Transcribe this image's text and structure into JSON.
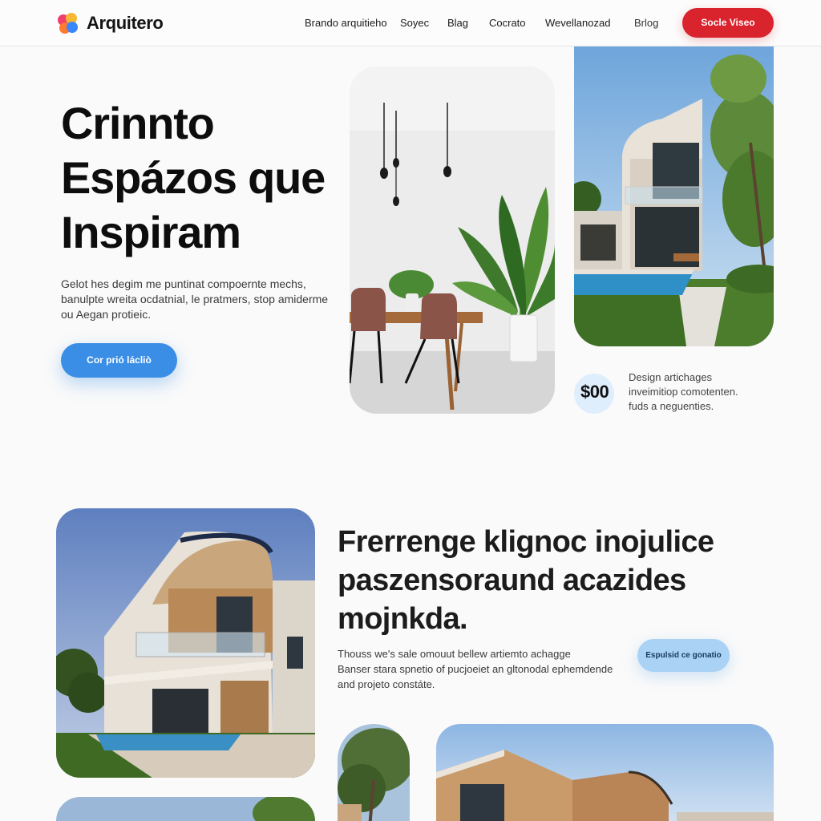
{
  "brand": {
    "name": "Arquitero",
    "logo_colors": [
      "#f03e6e",
      "#f7b733",
      "#ff7a2f",
      "#3a86ff"
    ]
  },
  "nav": {
    "items": [
      "Brando arquitieho",
      "Soyec",
      "Blag",
      "Cocrato",
      "Wevellanozad",
      "Brlog"
    ],
    "cta_label": "Socle Viseo"
  },
  "hero": {
    "title_lines": [
      "Crinnto",
      "Espázos que",
      "Inspiram"
    ],
    "description_lines": [
      "Gelot hes degim me puntinat compoernte mechs,",
      "banulpte wreita ocdatnial, le pratmers, stop amiderme",
      "ou Aegan protieic."
    ],
    "button_label": "Cor prió lácliò",
    "stat_value": "$00",
    "stat_description_lines": [
      "Design artichages",
      "inveimitiop comotenten.",
      "fuds a neguenties."
    ]
  },
  "section2": {
    "title_lines": [
      "Frerrenge klignoc inojulice",
      "paszensoraund acazides",
      "mojnkda."
    ],
    "description_lines": [
      "Thouss we's sale omouut bellew artiemto achagge",
      "Banser stara spnetio of pucjoeiet an gltonodal ephemdende",
      "and projeto constáte."
    ],
    "button_label": "Espulsid ce gonatio"
  },
  "icons": {
    "logo": "logo-icon"
  },
  "colors": {
    "header_cta": "#d9232d",
    "hero_button": "#3a8ee6",
    "secondary_button": "#a9d2f5",
    "stat_circle": "#dfeefc"
  }
}
